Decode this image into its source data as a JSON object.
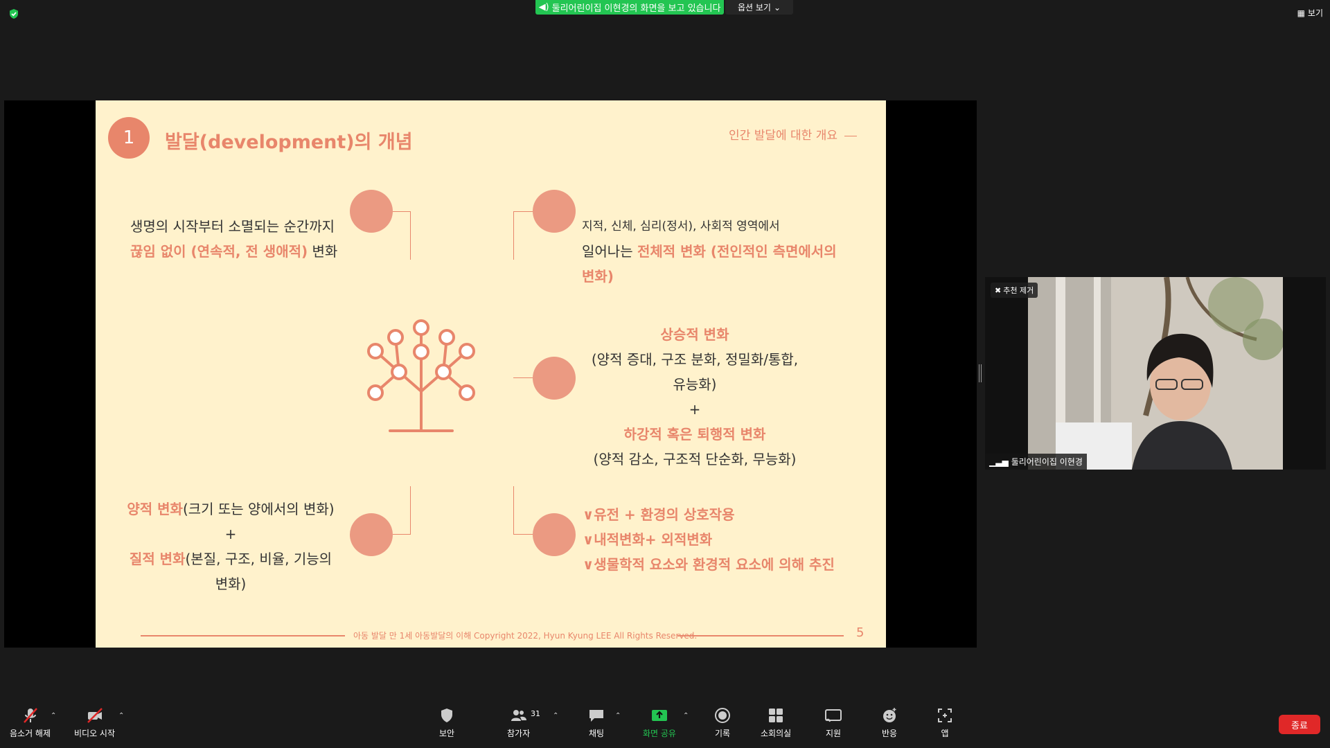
{
  "top_bar": {
    "share_banner": "둘리어린이집 이현경의 화면을 보고 있습니다",
    "view_options": "옵션 보기",
    "view": "보기"
  },
  "slide": {
    "number": "1",
    "title": "발달(development)의 개념",
    "subtitle": "인간 발달에 대한 개요",
    "tl_line1": "생명의 시작부터 소멸되는 순간까지",
    "tl_line2_acc": "끊임 없이 (연속적, 전 생애적)",
    "tl_line2_rest": " 변화",
    "tr_line1": "지적, 신체, 심리(정서), 사회적 영역에서",
    "tr_line2_pre": "일어나는 ",
    "tr_line2_acc": "전체적 변화 (전인적인 측면에서의",
    "tr_line3_acc": "변화)",
    "mr_h1": "상승적 변화",
    "mr_l1": "(양적 증대, 구조 분화, 정밀화/통합,",
    "mr_l2": "유능화)",
    "mr_plus": "+",
    "mr_h2": "하강적 혹은 퇴행적 변화",
    "mr_l3": "(양적 감소, 구조적 단순화, 무능화)",
    "bl_acc1": "양적 변화",
    "bl_rest1": "(크기 또는 양에서의 변화)",
    "bl_plus": "+",
    "bl_acc2": "질적 변화",
    "bl_rest2": "(본질, 구조, 비율, 기능의",
    "bl_l3": "변화)",
    "br_items": [
      "∨유전 + 환경의 상호작용",
      "∨내적변화+ 외적변화",
      "∨생물학적 요소와 환경적 요소에 의해 추진"
    ],
    "footer": "아동 발달 만 1세 아동발달의 이해 Copyright 2022, Hyun Kyung LEE All Rights Reserved.",
    "page": "5"
  },
  "video": {
    "pin_label": "추천 제거",
    "participant_name": "둘리어린이집 이현경"
  },
  "toolbar": {
    "unmute": "음소거 해제",
    "start_video": "비디오 시작",
    "security": "보안",
    "participants": "참가자",
    "participants_count": "31",
    "chat": "채팅",
    "share_screen": "화면 공유",
    "record": "기록",
    "breakout": "소회의실",
    "support": "지원",
    "reactions": "반응",
    "apps": "앱",
    "end": "종료"
  },
  "colors": {
    "accent": "#e8866b",
    "slide_bg": "#fff2cc",
    "share_green": "#23c552",
    "end_red": "#e02828"
  }
}
